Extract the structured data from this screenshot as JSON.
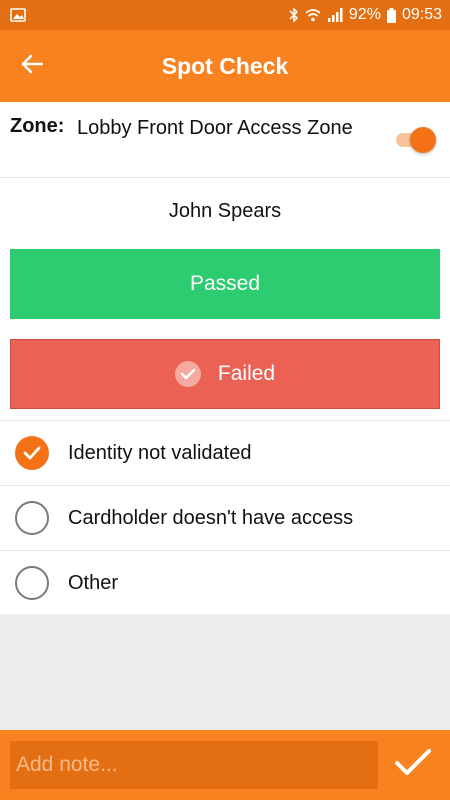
{
  "status_bar": {
    "battery": "92%",
    "time": "09:53",
    "icons": [
      "image-icon",
      "bluetooth-icon",
      "wifi-icon",
      "signal-icon",
      "battery-icon"
    ]
  },
  "app_bar": {
    "title": "Spot Check",
    "back_icon": "arrow-left-icon"
  },
  "zone": {
    "label": "Zone:",
    "value": "Lobby Front Door Access Zone",
    "toggle_on": true
  },
  "person": {
    "name": "John Spears"
  },
  "result": {
    "passed_label": "Passed",
    "failed_label": "Failed",
    "selected": "Failed"
  },
  "reasons": [
    {
      "label": "Identity not validated",
      "checked": true
    },
    {
      "label": "Cardholder doesn't have access",
      "checked": false
    },
    {
      "label": "Other",
      "checked": false
    }
  ],
  "note": {
    "placeholder": "Add note...",
    "value": ""
  },
  "colors": {
    "primary": "#f7821f",
    "primary_dark": "#e46f12",
    "passed": "#2ecc71",
    "failed": "#eb6153",
    "accent": "#f47216"
  }
}
